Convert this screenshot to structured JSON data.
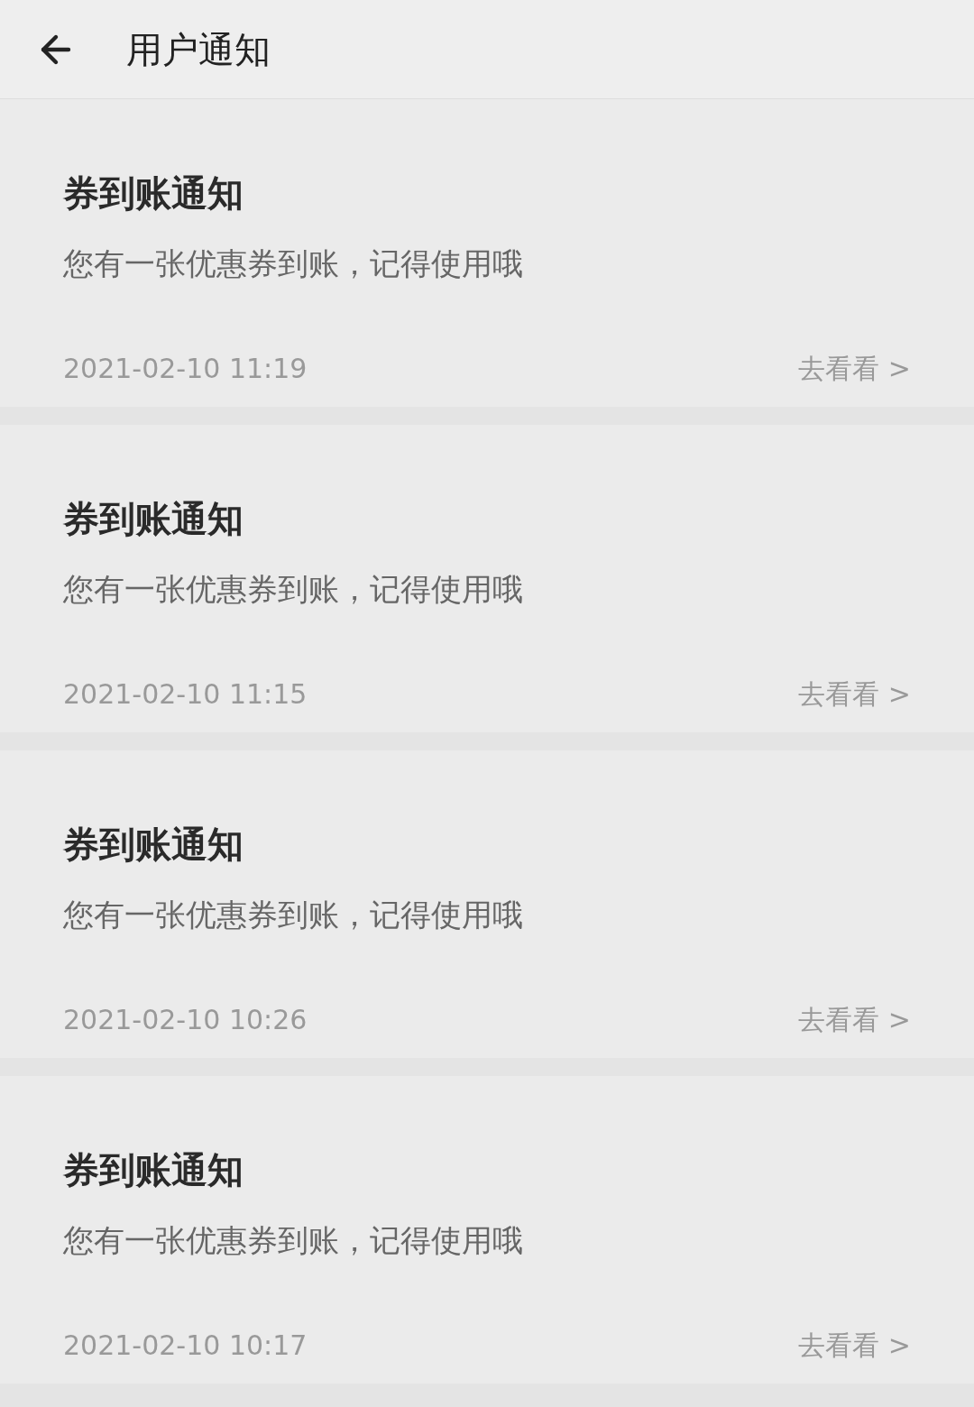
{
  "header": {
    "title": "用户通知"
  },
  "notifications": [
    {
      "title": "券到账通知",
      "message": "您有一张优惠券到账，记得使用哦",
      "time": "2021-02-10 11:19",
      "action": "去看看 >"
    },
    {
      "title": "券到账通知",
      "message": "您有一张优惠券到账，记得使用哦",
      "time": "2021-02-10 11:15",
      "action": "去看看 >"
    },
    {
      "title": "券到账通知",
      "message": "您有一张优惠券到账，记得使用哦",
      "time": "2021-02-10 10:26",
      "action": "去看看 >"
    },
    {
      "title": "券到账通知",
      "message": "您有一张优惠券到账，记得使用哦",
      "time": "2021-02-10 10:17",
      "action": "去看看 >"
    }
  ]
}
